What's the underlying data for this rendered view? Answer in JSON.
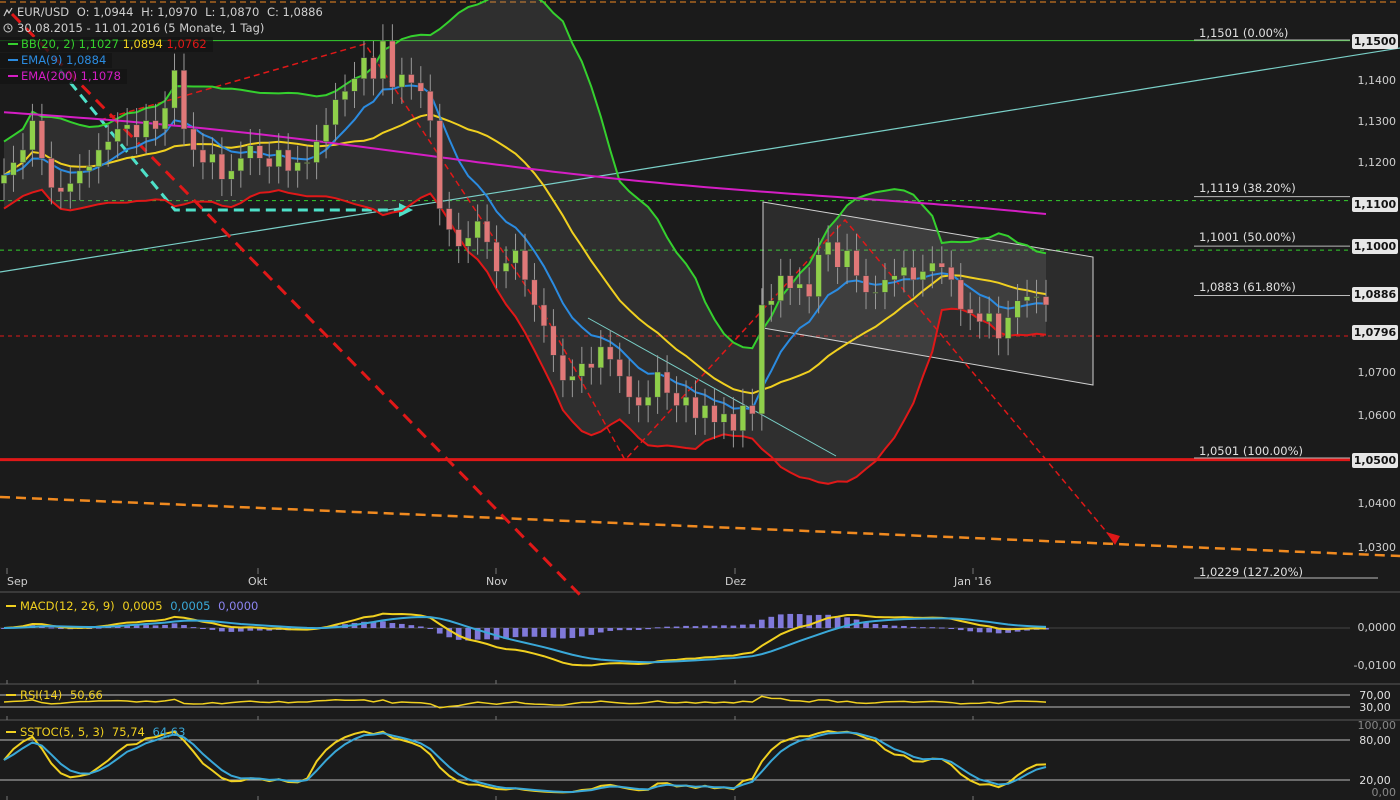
{
  "header": {
    "symbol": "EUR/USD",
    "open": "O: 1,0944",
    "high": "H: 1,0970",
    "low": "L: 1,0870",
    "close": "C: 1,0886",
    "range": "30.08.2015 - 11.01.2016 (5 Monate, 1 Tag)"
  },
  "legend": {
    "bb": {
      "name": "BB(20, 2)",
      "v1": "1,1027",
      "v2": "1,0894",
      "v3": "1,0762",
      "color": "#35d02e",
      "mid_color": "#f0d020",
      "low_color": "#e01818"
    },
    "ema9": {
      "name": "EMA(9)",
      "v": "1,0884",
      "color": "#2b8be0"
    },
    "ema200": {
      "name": "EMA(200)",
      "v": "1,1078",
      "color": "#d41ec4"
    }
  },
  "fib_levels": [
    {
      "label": "1,1501 (0.00%)",
      "price": 1.1501,
      "box": "1,1500"
    },
    {
      "label": "1,1119 (38.20%)",
      "price": 1.1119,
      "box": "1,1100"
    },
    {
      "label": "1,1001 (50.00%)",
      "price": 1.1001,
      "box": "1,1000"
    },
    {
      "label": "1,0883 (61.80%)",
      "price": 1.0883,
      "box": "1,0886"
    },
    {
      "label": "1,0501 (100.00%)",
      "price": 1.0501,
      "box": "1,0500"
    },
    {
      "label": "1,0229 (127.20%)",
      "price": 1.0229,
      "box": ""
    }
  ],
  "extra_box": {
    "label": "1,0796",
    "price": 1.0796
  },
  "price_axis": [
    "1,1400",
    "1,1300",
    "1,1200",
    "1,0700",
    "1,0600",
    "1,0400",
    "1,0300"
  ],
  "price_axis_values": [
    1.14,
    1.13,
    1.12,
    1.07,
    1.06,
    1.04,
    1.03
  ],
  "x_axis": [
    "Sep",
    "Okt",
    "Nov",
    "Dez",
    "Jan '16"
  ],
  "macd": {
    "name": "MACD(12, 26, 9)",
    "v1": "0,0005",
    "v2": "0,0005",
    "v3": "0,0000",
    "axis": [
      "0,0000",
      "-0,0100"
    ]
  },
  "rsi": {
    "name": "RSI(14)",
    "v": "50,66",
    "axis": [
      "70,00",
      "30,00"
    ]
  },
  "sstoc": {
    "name": "SSTOC(5, 5, 3)",
    "v1": "75,74",
    "v2": "64,63",
    "axis": [
      "100,00",
      "80,00",
      "20,00",
      "0,00"
    ]
  },
  "colors": {
    "up": "#8fcf4a",
    "down": "#e07878",
    "bb_upper": "#35d02e",
    "bb_mid": "#f0d020",
    "bb_lower": "#e01818",
    "ema9": "#2b8be0",
    "ema200": "#d41ec4",
    "support": "#e01818",
    "trend": "#7ad0c8",
    "orange": "#f08a20",
    "cyan_arrow": "#4ee0c8",
    "macd_hist": "#8c84f0",
    "signal_blue": "#3aa8d8"
  },
  "chart_data": {
    "type": "candlestick",
    "title": "EUR/USD",
    "x": [
      "30.08.2015",
      "11.01.2016"
    ],
    "categories": [
      "Sep",
      "Okt",
      "Nov",
      "Dez",
      "Jan '16"
    ],
    "ylim": [
      1.025,
      1.16
    ],
    "series": [
      {
        "name": "EUR/USD",
        "close": [
          1.118,
          1.121,
          1.124,
          1.131,
          1.122,
          1.115,
          1.114,
          1.116,
          1.119,
          1.12,
          1.124,
          1.126,
          1.129,
          1.13,
          1.127,
          1.131,
          1.129,
          1.134,
          1.143,
          1.129,
          1.124,
          1.121,
          1.123,
          1.117,
          1.119,
          1.122,
          1.125,
          1.122,
          1.12,
          1.124,
          1.119,
          1.121,
          1.121,
          1.126,
          1.13,
          1.136,
          1.138,
          1.141,
          1.146,
          1.141,
          1.15,
          1.139,
          1.142,
          1.14,
          1.138,
          1.131,
          1.11,
          1.105,
          1.101,
          1.103,
          1.107,
          1.102,
          1.095,
          1.097,
          1.1,
          1.093,
          1.087,
          1.082,
          1.075,
          1.069,
          1.07,
          1.073,
          1.072,
          1.077,
          1.074,
          1.07,
          1.065,
          1.063,
          1.065,
          1.071,
          1.066,
          1.063,
          1.065,
          1.06,
          1.063,
          1.059,
          1.061,
          1.057,
          1.063,
          1.061,
          1.087,
          1.088,
          1.094,
          1.091,
          1.092,
          1.089,
          1.099,
          1.102,
          1.096,
          1.1,
          1.094,
          1.09,
          1.09,
          1.093,
          1.094,
          1.096,
          1.093,
          1.095,
          1.097,
          1.096,
          1.093,
          1.086,
          1.085,
          1.083,
          1.085,
          1.079,
          1.084,
          1.088,
          1.089,
          1.089,
          1.087
        ]
      },
      {
        "name": "BB(20, 2)",
        "upper": [],
        "middle": [],
        "lower": []
      },
      {
        "name": "EMA(9)",
        "values": []
      },
      {
        "name": "EMA(200)",
        "values": []
      }
    ]
  }
}
